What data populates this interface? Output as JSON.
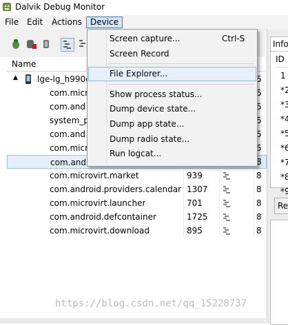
{
  "window": {
    "title": "Dalvik Debug Monitor",
    "app_icon": "android-debug-icon"
  },
  "menubar": {
    "items": [
      {
        "label": "File"
      },
      {
        "label": "Edit"
      },
      {
        "label": "Actions"
      },
      {
        "label": "Device",
        "open": true
      }
    ]
  },
  "toolbar": {
    "buttons": [
      "debug-icon",
      "update-heap-icon",
      "gc-icon",
      "update-threads-icon",
      "start-method-profiling-icon"
    ]
  },
  "devices_table": {
    "headers": {
      "name": "Name"
    },
    "device": {
      "name": "lge-lg_h990c"
    },
    "processes": [
      {
        "name": "com.micro",
        "pid": "",
        "port": ""
      },
      {
        "name": "com.and",
        "pid": "",
        "port": ""
      },
      {
        "name": "system_p",
        "pid": "",
        "port": ""
      },
      {
        "name": "com.and",
        "pid": "",
        "port": ""
      },
      {
        "name": "com.micr",
        "pid": "",
        "port": ""
      },
      {
        "name": "com.and",
        "pid": "",
        "port": "",
        "selected": true
      },
      {
        "name": "com.microvirt.market",
        "pid": "939",
        "port": "8"
      },
      {
        "name": "com.android.providers.calendar",
        "pid": "1307",
        "port": "8"
      },
      {
        "name": "com.microvirt.launcher",
        "pid": "701",
        "port": "8"
      },
      {
        "name": "com.android.defcontainer",
        "pid": "1725",
        "port": "8"
      },
      {
        "name": "com.microvirt.download",
        "pid": "895",
        "port": "8"
      }
    ]
  },
  "right_panel": {
    "tab_label": "Info",
    "column_header": "ID",
    "ids": [
      "1",
      "*2",
      "*3",
      "*4",
      "*5",
      "*6",
      "*7",
      "*8",
      "*9"
    ],
    "button_label": "Re"
  },
  "partially_hidden_column": [
    "5",
    "5",
    "5",
    "5",
    "5",
    "5",
    "8"
  ],
  "device_menu": {
    "items": [
      {
        "label": "Screen capture...",
        "shortcut": "Ctrl-S"
      },
      {
        "label": "Screen Record",
        "shortcut": ""
      },
      {
        "label": "File Explorer...",
        "shortcut": "",
        "highlighted": true
      },
      {
        "label": "Show process status...",
        "shortcut": ""
      },
      {
        "label": "Dump device state...",
        "shortcut": ""
      },
      {
        "label": "Dump app state...",
        "shortcut": ""
      },
      {
        "label": "Dump radio state...",
        "shortcut": ""
      },
      {
        "label": "Run logcat...",
        "shortcut": ""
      }
    ]
  },
  "watermark": "https://blog.csdn.net/qq_15228737",
  "colors": {
    "menu_highlight": "#cfe6fb",
    "selection": "#e3effa",
    "border_accent": "#3c7fb1"
  }
}
